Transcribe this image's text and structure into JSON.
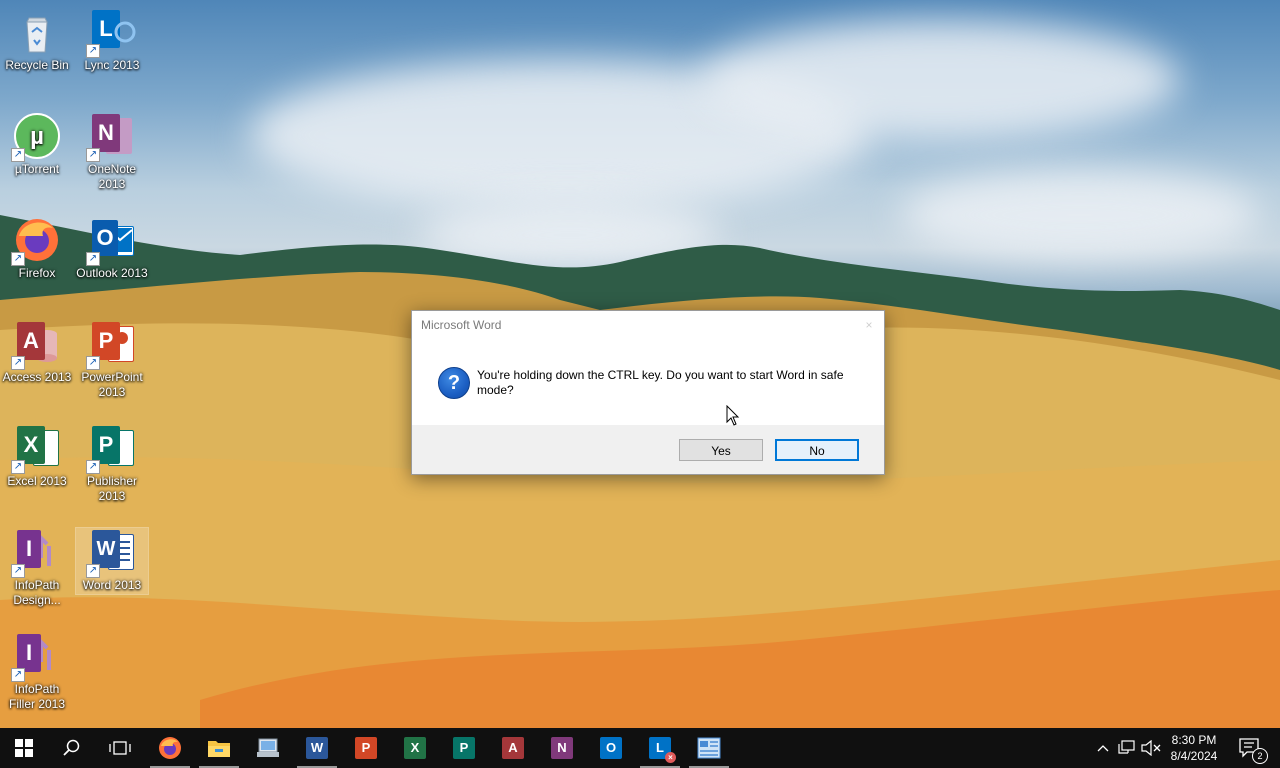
{
  "desktop": {
    "icons": [
      {
        "label": "Recycle Bin",
        "icon": "recycle-bin-icon"
      },
      {
        "label": "Lync 2013",
        "icon": "lync-icon"
      },
      {
        "label": "µTorrent",
        "icon": "utorrent-icon"
      },
      {
        "label": "OneNote 2013",
        "icon": "onenote-icon"
      },
      {
        "label": "Firefox",
        "icon": "firefox-icon"
      },
      {
        "label": "Outlook 2013",
        "icon": "outlook-icon"
      },
      {
        "label": "Access 2013",
        "icon": "access-icon"
      },
      {
        "label": "PowerPoint 2013",
        "icon": "powerpoint-icon"
      },
      {
        "label": "Excel 2013",
        "icon": "excel-icon"
      },
      {
        "label": "Publisher 2013",
        "icon": "publisher-icon"
      },
      {
        "label": "InfoPath Design...",
        "icon": "infopath-designer-icon"
      },
      {
        "label": "Word 2013",
        "icon": "word-icon"
      },
      {
        "label": "InfoPath Filler 2013",
        "icon": "infopath-filler-icon"
      }
    ]
  },
  "dialog": {
    "title": "Microsoft Word",
    "message": "You're holding down the CTRL key. Do you want to start Word in safe mode?",
    "yes_label": "Yes",
    "no_label": "No",
    "close_glyph": "×"
  },
  "taskbar": {
    "apps": [
      "firefox-icon",
      "file-explorer-icon",
      "control-panel-icon",
      "word-icon",
      "powerpoint-icon",
      "excel-icon",
      "publisher-icon",
      "access-icon",
      "onenote-icon",
      "outlook-icon",
      "lync-icon",
      "infopath-icon"
    ],
    "time": "8:30 PM",
    "date": "8/4/2024",
    "notification_count": "2"
  },
  "colors": {
    "word": "#2b579a",
    "excel": "#217346",
    "powerpoint": "#d24726",
    "onenote": "#80397b",
    "outlook": "#0072c6",
    "access": "#a4373a",
    "publisher": "#077568",
    "infopath": "#77338f",
    "lync": "#0072c6",
    "accent": "#0078d7"
  }
}
